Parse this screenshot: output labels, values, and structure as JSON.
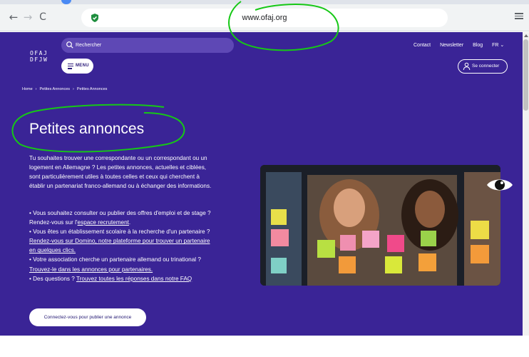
{
  "browser": {
    "url": "www.ofaj.org",
    "back_icon": "←",
    "forward_icon": "→",
    "reload_icon": "C"
  },
  "header": {
    "logo_line1": "OFAJ",
    "logo_line2": "DFJW",
    "search_label": "Rechercher",
    "menu_label": "MENU",
    "links": [
      "Contact",
      "Newsletter",
      "Blog",
      "FR ⌄"
    ],
    "connect_label": "Se connecter"
  },
  "breadcrumb": [
    "Home",
    "Petites Annonces",
    "Petites Annonces"
  ],
  "breadcrumb_separator": "›",
  "title": "Petites annonces",
  "intro": "Tu souhaites trouver une correspondante ou un correspondant ou un logement en Allemagne ? Les petites annonces, actuelles et ciblées, sont particulièrement utiles à toutes celles et ceux qui cherchent à établir un partenariat franco-allemand ou à échanger des informations.",
  "bullets": [
    {
      "text": "•  Vous souhaitez consulter ou publier des offres d'emploi et de stage ? Rendez-vous sur l'",
      "link": "espace recrutement",
      "after": "."
    },
    {
      "text": "•  Vous êtes un établissement scolaire à la recherche d'un partenaire ? ",
      "link": "Rendez-vous sur Domino, notre plateforme pour trouver un partenaire en quelques clics.",
      "after": ""
    },
    {
      "text": "•  Votre association cherche un partenaire allemand ou trinational ? ",
      "link": "Trouvez-le dans les annonces pour partenaires.",
      "after": ""
    },
    {
      "text": "•  Des questions ? ",
      "link": "Trouvez toutes les réponses dans notre FAQ",
      "after": ""
    }
  ],
  "cta_label": "Connectez-vous pour publier une annonce",
  "colors": {
    "page_background": "#3a2496",
    "search_background": "#5e48b5",
    "annotation": "#16c816"
  }
}
